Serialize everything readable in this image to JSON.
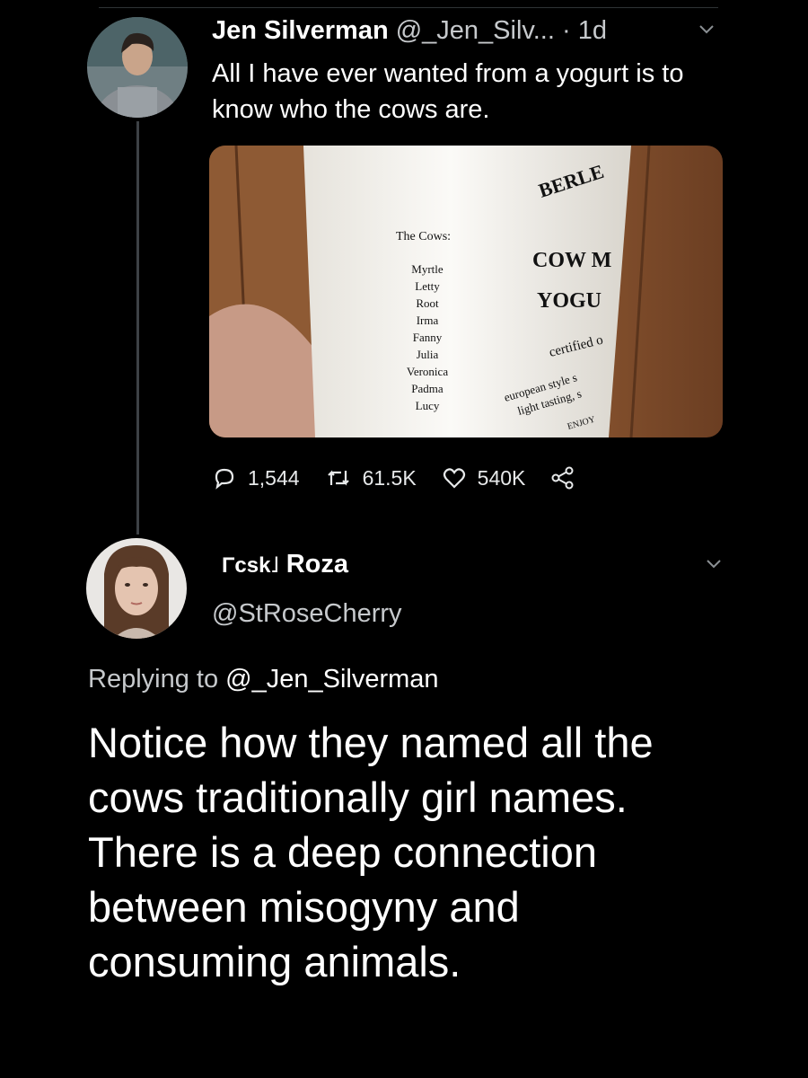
{
  "tweet": {
    "author_name": "Jen Silverman",
    "author_handle": "@_Jen_Silv...",
    "time": "· 1d",
    "text": "All I have ever wanted from a yogurt is to know who the cows are.",
    "image": {
      "label_heading": "The Cows:",
      "cow_names": [
        "Myrtle",
        "Letty",
        "Root",
        "Irma",
        "Fanny",
        "Julia",
        "Veronica",
        "Padma",
        "Lucy"
      ],
      "brand": "BERLE",
      "product_line1": "COW M",
      "product_line2": "YOGU",
      "certified": "certified o",
      "tagline1": "european style s",
      "tagline2": "light tasting, s",
      "enjoy": "ENJOY"
    },
    "stats": {
      "replies": "1,544",
      "retweets": "61.5K",
      "likes": "540K"
    }
  },
  "reply": {
    "author_tag": "Γcsk˩",
    "author_name": "Roza",
    "author_handle": "@StRoseCherry",
    "replying_prefix": "Replying to",
    "replying_handle": "@_Jen_Silverman",
    "text": "Notice how they named all the cows traditionally girl names. There is a deep connection between misogyny and consuming animals."
  },
  "icons": [
    "reply-icon",
    "retweet-icon",
    "like-icon",
    "share-icon",
    "chevron-down-icon"
  ],
  "colors": {
    "background": "#000000",
    "text": "#ffffff",
    "muted": "#c6c9cc",
    "thread_line": "#3d4145"
  }
}
